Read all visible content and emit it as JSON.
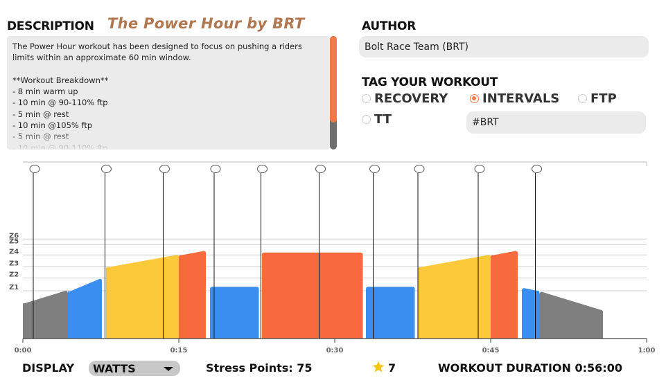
{
  "description": {
    "header": "DESCRIPTION",
    "workout_title": "The Power Hour by BRT",
    "text": "The Power Hour workout has been designed to focus on pushing a riders limits within an approximate 60 min window.\n\n**Workout Breakdown**\n- 8 min warm up\n- 10 min @ 90-110% ftp\n- 5 min @ rest\n- 10 min @105% ftp\n- 5 min @ rest\n- 10 min @ 90-110% ftp"
  },
  "author": {
    "header": "AUTHOR",
    "value": "Bolt Race Team (BRT)"
  },
  "tags": {
    "header": "TAG YOUR WORKOUT",
    "options": [
      {
        "label": "RECOVERY",
        "selected": false
      },
      {
        "label": "INTERVALS",
        "selected": true
      },
      {
        "label": "FTP",
        "selected": false
      },
      {
        "label": "TT",
        "selected": false
      }
    ],
    "custom_tag": "#BRT"
  },
  "chart_data": {
    "type": "area",
    "x_ticks": [
      "0:00",
      "0:15",
      "0:30",
      "0:45",
      "1:00"
    ],
    "xlim_minutes": [
      0,
      60
    ],
    "zone_labels": [
      "Z1",
      "Z2",
      "Z3",
      "Z4",
      "Z5",
      "Z6"
    ],
    "zone_lines_ftp_fraction": [
      0.6,
      0.76,
      0.9,
      1.05,
      1.18,
      1.25
    ],
    "segments": [
      {
        "start": 0.0,
        "end": 4.3,
        "from": 0.45,
        "to": 0.6,
        "color": "#7f7f7f"
      },
      {
        "start": 4.3,
        "end": 7.6,
        "from": 0.6,
        "to": 0.75,
        "color": "#3a8ef0"
      },
      {
        "start": 8.0,
        "end": 15.0,
        "from": 0.9,
        "to": 1.05,
        "color": "#fcc93a"
      },
      {
        "start": 15.0,
        "end": 17.6,
        "from": 1.05,
        "to": 1.1,
        "color": "#f66a3d"
      },
      {
        "start": 18.0,
        "end": 22.7,
        "from": 0.65,
        "to": 0.65,
        "color": "#3a8ef0"
      },
      {
        "start": 23.0,
        "end": 32.7,
        "from": 1.08,
        "to": 1.08,
        "color": "#f66a3d"
      },
      {
        "start": 33.0,
        "end": 37.7,
        "from": 0.65,
        "to": 0.65,
        "color": "#3a8ef0"
      },
      {
        "start": 38.0,
        "end": 45.0,
        "from": 0.9,
        "to": 1.05,
        "color": "#fcc93a"
      },
      {
        "start": 45.0,
        "end": 47.6,
        "from": 1.05,
        "to": 1.1,
        "color": "#f66a3d"
      },
      {
        "start": 48.0,
        "end": 49.7,
        "from": 0.63,
        "to": 0.6,
        "color": "#3a8ef0"
      },
      {
        "start": 49.7,
        "end": 55.8,
        "from": 0.58,
        "to": 0.36,
        "color": "#7f7f7f"
      }
    ],
    "markers_minutes": [
      0.6,
      7.5,
      13.1,
      18.0,
      22.5,
      28.1,
      33.3,
      37.6,
      43.4,
      48.9
    ]
  },
  "footer": {
    "display_label": "DISPLAY",
    "display_value": "WATTS",
    "stress_points": "Stress Points: 75",
    "stars": "7",
    "duration": "WORKOUT DURATION 0:56:00"
  },
  "colors": {
    "accent": "#f07a4a",
    "title_brown": "#b07850",
    "star": "#f5c518"
  }
}
